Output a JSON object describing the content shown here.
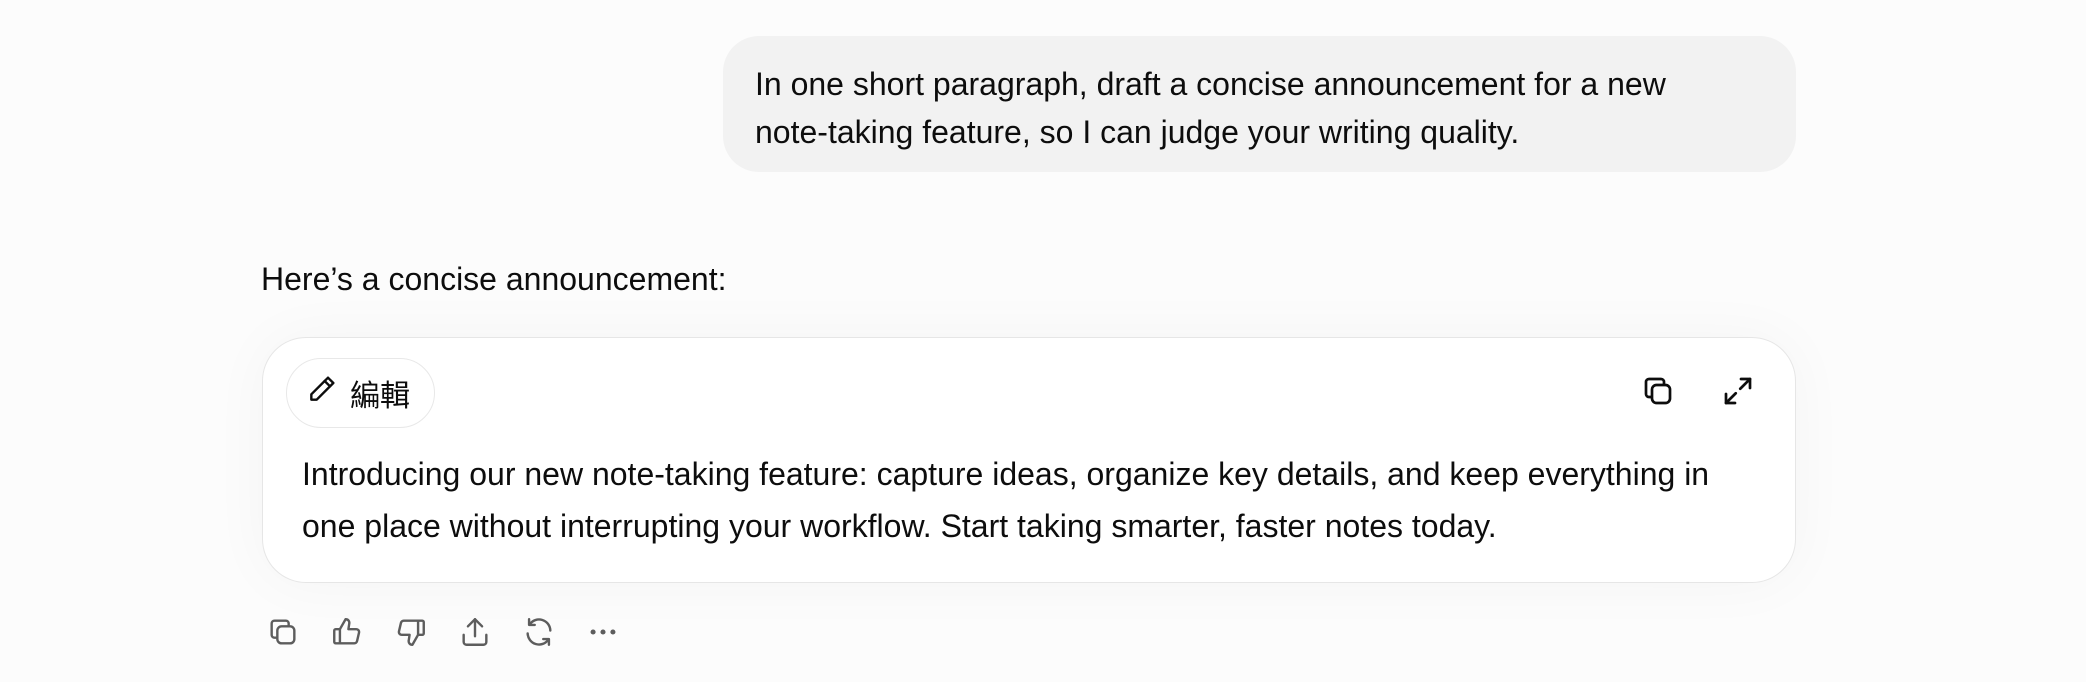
{
  "conversation": {
    "user_message": "In one short paragraph, draft a concise announcement for a new\nnote-taking feature, so I can judge your writing quality.",
    "assistant_intro": "Here’s a concise announcement:",
    "canvas": {
      "edit_label": "編輯",
      "content": "Introducing our new note-taking feature: capture ideas, organize key details, and keep everything in one place without interrupting your workflow. Start taking smarter, faster notes today.",
      "icons": [
        "pencil-icon",
        "copy-icon",
        "expand-icon"
      ]
    },
    "actions": [
      "copy-icon",
      "thumbs-up-icon",
      "thumbs-down-icon",
      "share-icon",
      "regenerate-icon",
      "more-icon"
    ]
  },
  "colors": {
    "background": "#fcfcfc",
    "user_bubble": "#f2f2f2",
    "card_border": "#e6e6e6",
    "icon": "#5d5d5d",
    "text": "#0d0d0d"
  }
}
